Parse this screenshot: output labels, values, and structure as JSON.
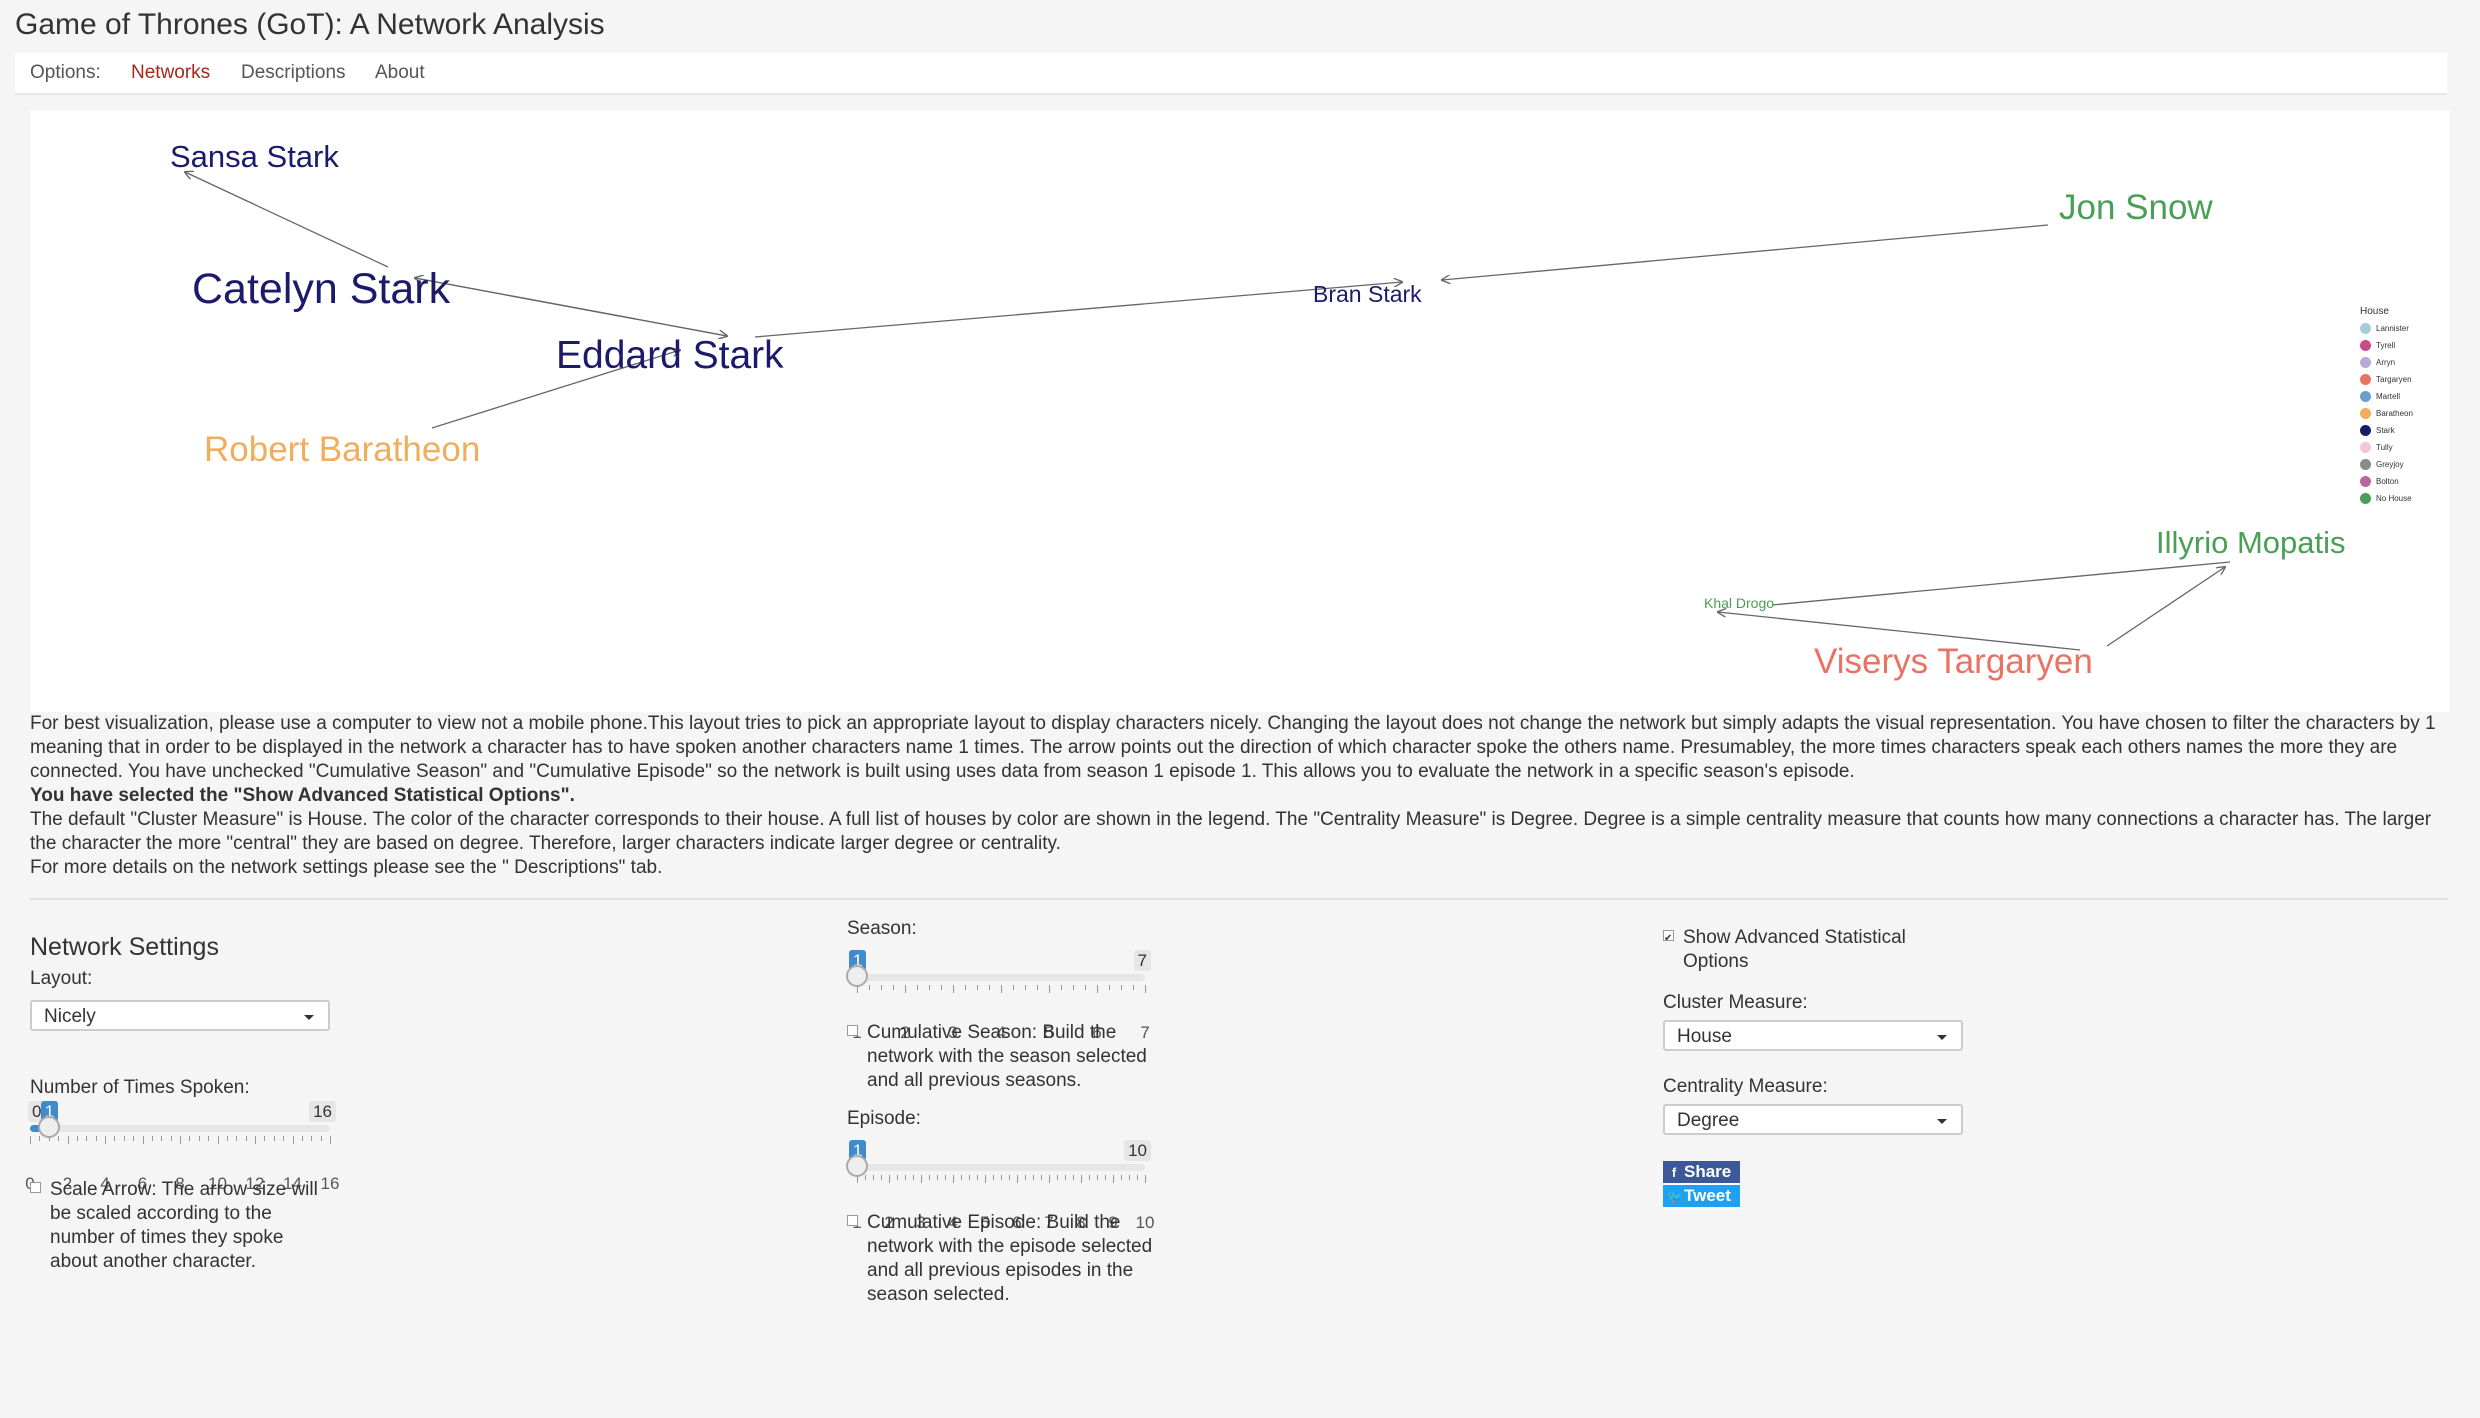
{
  "app": {
    "title": "Game of Thrones (GoT): A Network Analysis"
  },
  "nav": {
    "options_label": "Options:",
    "tabs": [
      {
        "label": "Networks",
        "active": true
      },
      {
        "label": "Descriptions",
        "active": false
      },
      {
        "label": "About",
        "active": false
      }
    ]
  },
  "network": {
    "nodes": [
      {
        "name": "Sansa Stark",
        "house": "Stark"
      },
      {
        "name": "Catelyn Stark",
        "house": "Stark"
      },
      {
        "name": "Eddard Stark",
        "house": "Stark"
      },
      {
        "name": "Robert Baratheon",
        "house": "Baratheon"
      },
      {
        "name": "Bran Stark",
        "house": "Stark"
      },
      {
        "name": "Jon Snow",
        "house": "No House"
      },
      {
        "name": "Illyrio Mopatis",
        "house": "No House"
      },
      {
        "name": "Khal Drogo",
        "house": "No House"
      },
      {
        "name": "Viserys Targaryen",
        "house": "Targaryen"
      }
    ],
    "legend": {
      "title": "House",
      "items": [
        {
          "label": "Lannister",
          "color": "#a6cfd5"
        },
        {
          "label": "Tyrell",
          "color": "#c94c8a"
        },
        {
          "label": "Arryn",
          "color": "#b8a9d6"
        },
        {
          "label": "Targaryen",
          "color": "#e97363"
        },
        {
          "label": "Martell",
          "color": "#6a9fcf"
        },
        {
          "label": "Baratheon",
          "color": "#f0ad5c"
        },
        {
          "label": "Stark",
          "color": "#1c1a6b"
        },
        {
          "label": "Tully",
          "color": "#f3c6d8"
        },
        {
          "label": "Greyjoy",
          "color": "#8a8a8a"
        },
        {
          "label": "Bolton",
          "color": "#b56a9a"
        },
        {
          "label": "No House",
          "color": "#4a9e55"
        }
      ]
    }
  },
  "info": {
    "paragraph1": "For best visualization, please use a computer to view not a mobile phone.This layout tries to pick an appropriate layout to display characters nicely. Changing the layout does not change the network but simply adapts the visual representation. You have chosen to filter the characters by 1 meaning that in order to be displayed in the network a character has to have spoken another characters name 1 times. The arrow points out the direction of which character spoke the others name. Presumabley, the more times characters speak each others names the more they are connected. You have unchecked \"Cumulative Season\" and \"Cumulative Episode\" so the network is built using uses data from season 1 episode 1. This allows you to evaluate the network in a specific season's episode.",
    "advanced_notice": "You have selected the \"Show Advanced Statistical Options\".",
    "paragraph2": "The default \"Cluster Measure\" is House. The color of the character corresponds to their house. A full list of houses by color are shown in the legend. The \"Centrality Measure\" is Degree. Degree is a simple centrality measure that counts how many connections a character has. The larger the character the more \"central\" they are based on degree. Therefore, larger characters indicate larger degree or centrality.",
    "paragraph3": "For more details on the network settings please see the \" Descriptions\" tab."
  },
  "settings": {
    "title": "Network Settings",
    "layout": {
      "label": "Layout:",
      "value": "Nicely"
    },
    "times_spoken": {
      "label": "Number of Times Spoken:",
      "min": 0,
      "max": 16,
      "value": 1,
      "min_label": "0",
      "max_label": "16",
      "value_label": "1",
      "ticks": [
        "0",
        "2",
        "4",
        "6",
        "8",
        "10",
        "12",
        "14",
        "16"
      ]
    },
    "scale_arrow": {
      "checked": false,
      "text": "Scale Arrow: The arrow size will be scaled according to the number of times they spoke about another character."
    },
    "season": {
      "label": "Season:",
      "min": 1,
      "max": 7,
      "value": 1,
      "value_label": "1",
      "max_label": "7",
      "ticks": [
        "1",
        "2",
        "3",
        "4",
        "5",
        "6",
        "7"
      ]
    },
    "cumulative_season": {
      "checked": false,
      "text": "Cumulative Season: Build the network with the season selected and all previous seasons."
    },
    "episode": {
      "label": "Episode:",
      "min": 1,
      "max": 10,
      "value": 1,
      "value_label": "1",
      "max_label": "10",
      "ticks": [
        "1",
        "2",
        "3",
        "4",
        "5",
        "6",
        "7",
        "8",
        "9",
        "10"
      ]
    },
    "cumulative_episode": {
      "checked": false,
      "text": "Cumulative Episode: Build the network with the episode selected and all previous episodes in the season selected."
    },
    "advanced": {
      "checked": true,
      "text": "Show Advanced Statistical Options"
    },
    "cluster": {
      "label": "Cluster Measure:",
      "value": "House"
    },
    "centrality": {
      "label": "Centrality Measure:",
      "value": "Degree"
    },
    "share": {
      "facebook_label": "Share",
      "twitter_label": "Tweet",
      "facebook_icon": "facebook-icon",
      "twitter_icon": "twitter-icon"
    }
  }
}
